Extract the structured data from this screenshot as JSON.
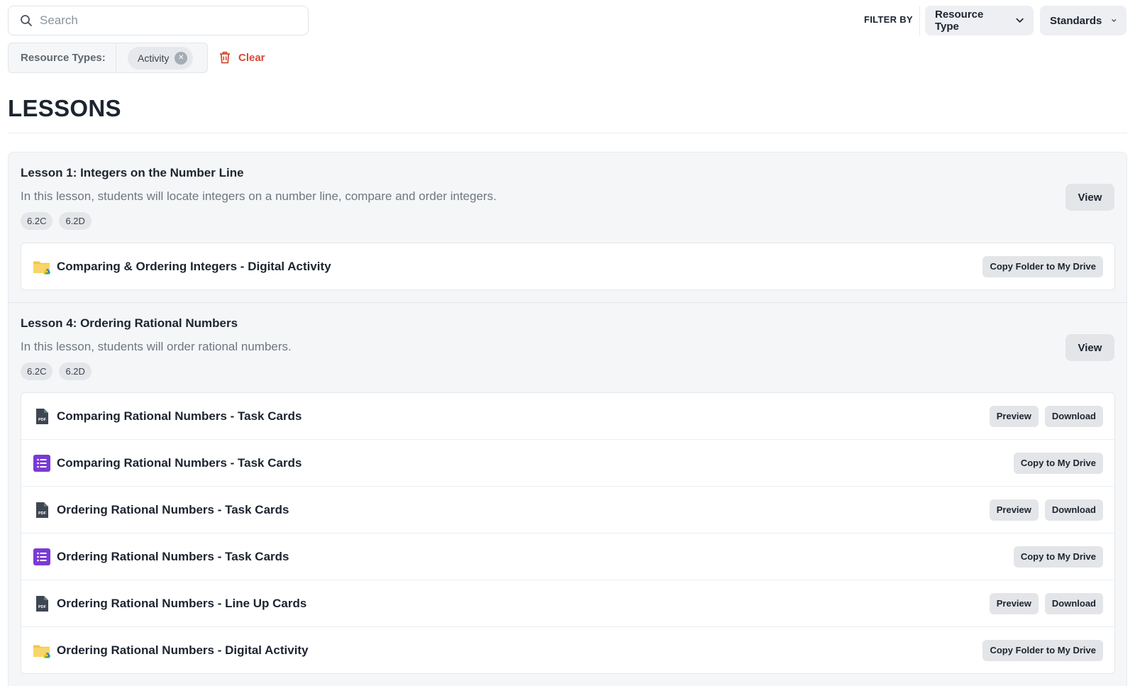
{
  "search": {
    "placeholder": "Search",
    "icon": "search-icon"
  },
  "filters": {
    "label": "FILTER BY",
    "resource_type": "Resource Type",
    "standards": "Standards"
  },
  "active_filters": {
    "label": "Resource Types:",
    "chips": [
      "Activity"
    ],
    "clear_label": "Clear"
  },
  "page_title": "LESSONS",
  "colors": {
    "accent_red": "#d24a33",
    "forms_purple": "#7a3ad6",
    "folder_yellow": "#f4c54a"
  },
  "lessons": [
    {
      "title": "Lesson 1: Integers on the Number Line",
      "description": "In this lesson, students will locate integers on a number line, compare and order integers.",
      "tags": [
        "6.2C",
        "6.2D"
      ],
      "view_label": "View",
      "resources": [
        {
          "icon": "drive-folder-icon",
          "title": "Comparing & Ordering Integers - Digital Activity",
          "actions": [
            "Copy Folder to My Drive"
          ]
        }
      ]
    },
    {
      "title": "Lesson 4: Ordering Rational Numbers",
      "description": "In this lesson, students will order rational numbers.",
      "tags": [
        "6.2C",
        "6.2D"
      ],
      "view_label": "View",
      "resources": [
        {
          "icon": "pdf-icon",
          "title": "Comparing Rational Numbers - Task Cards",
          "actions": [
            "Preview",
            "Download"
          ]
        },
        {
          "icon": "forms-icon",
          "title": "Comparing Rational Numbers - Task Cards",
          "actions": [
            "Copy to My Drive"
          ]
        },
        {
          "icon": "pdf-icon",
          "title": "Ordering Rational Numbers - Task Cards",
          "actions": [
            "Preview",
            "Download"
          ]
        },
        {
          "icon": "forms-icon",
          "title": "Ordering Rational Numbers - Task Cards",
          "actions": [
            "Copy to My Drive"
          ]
        },
        {
          "icon": "pdf-icon",
          "title": "Ordering Rational Numbers - Line Up Cards",
          "actions": [
            "Preview",
            "Download"
          ]
        },
        {
          "icon": "drive-folder-icon",
          "title": "Ordering Rational Numbers - Digital Activity",
          "actions": [
            "Copy Folder to My Drive"
          ]
        }
      ]
    }
  ]
}
